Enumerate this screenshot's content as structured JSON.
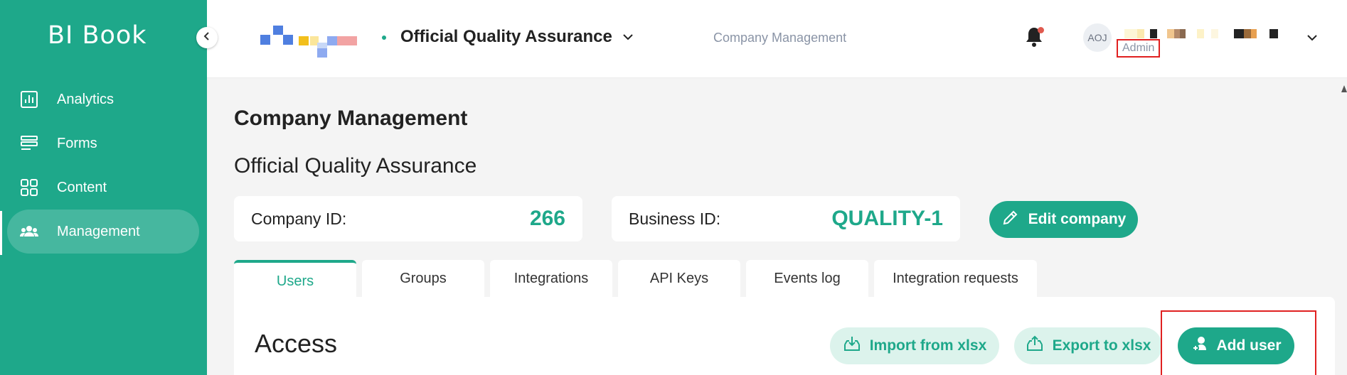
{
  "sidebar": {
    "brand": "BI Book",
    "items": [
      {
        "label": "Analytics",
        "icon": "bar-chart-icon"
      },
      {
        "label": "Forms",
        "icon": "forms-icon"
      },
      {
        "label": "Content",
        "icon": "grid-icon"
      },
      {
        "label": "Management",
        "icon": "users-icon",
        "active": true
      }
    ]
  },
  "header": {
    "company_name": "Official Quality Assurance",
    "breadcrumb": "Company Management",
    "avatar_initials": "AOJ",
    "role": "Admin"
  },
  "main": {
    "page_title": "Company Management",
    "company_title": "Official Quality Assurance",
    "company_id_label": "Company ID:",
    "company_id_value": "266",
    "business_id_label": "Business ID:",
    "business_id_value": "QUALITY-1",
    "edit_label": "Edit company",
    "tabs": [
      {
        "label": "Users",
        "active": true
      },
      {
        "label": "Groups"
      },
      {
        "label": "Integrations"
      },
      {
        "label": "API Keys"
      },
      {
        "label": "Events log"
      },
      {
        "label": "Integration requests"
      }
    ],
    "section_title": "Access",
    "import_label": "Import from xlsx",
    "export_label": "Export to xlsx",
    "add_user_label": "Add user"
  },
  "colors": {
    "accent": "#1ea88a",
    "accent_soft": "#dcf3ec",
    "highlight": "#e02020",
    "notification": "#e05a4f"
  }
}
